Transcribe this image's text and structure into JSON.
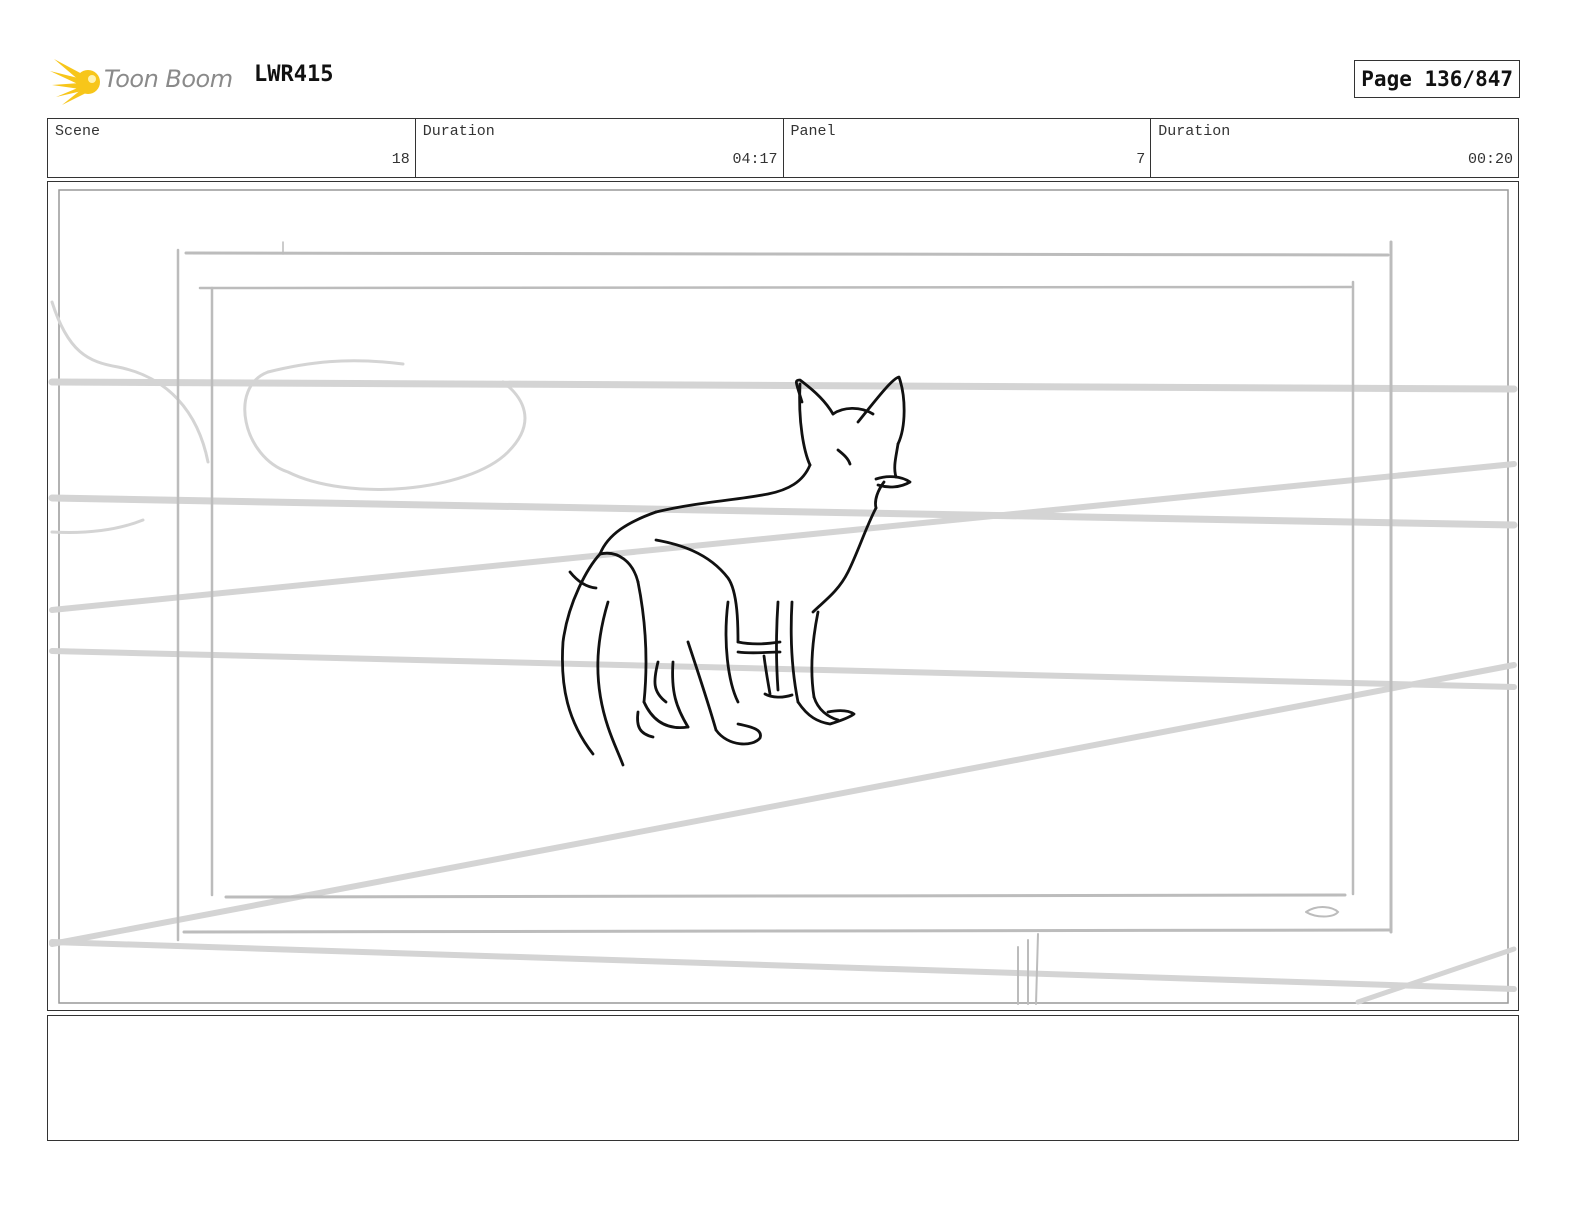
{
  "header": {
    "logo_text": "Toon Boom",
    "project_id": "LWR415",
    "page_label": "Page 136/847"
  },
  "info": [
    {
      "label": "Scene",
      "value": "18"
    },
    {
      "label": "Duration",
      "value": "04:17"
    },
    {
      "label": "Panel",
      "value": "7"
    },
    {
      "label": "Duration",
      "value": "00:20"
    }
  ],
  "notes": {
    "text": ""
  },
  "colors": {
    "logo_star": "#f7c61a",
    "logo_text": "#8a8a8a",
    "border": "#333333",
    "sketch_light": "#d0d0d0",
    "sketch_ink": "#111111"
  }
}
